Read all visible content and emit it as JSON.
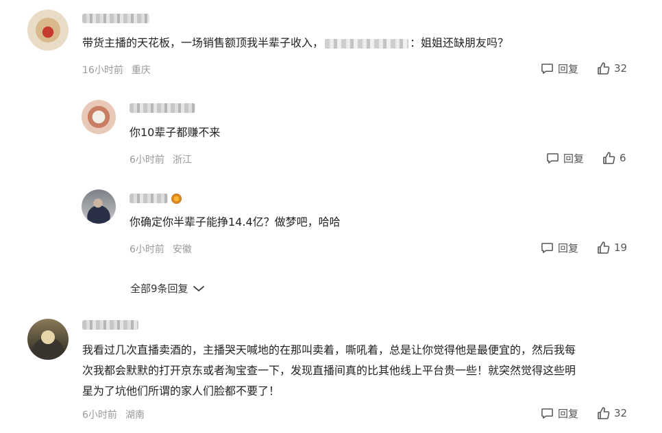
{
  "comments": [
    {
      "text_before": "带货主播的天花板，一场销售额顶我半辈子收入，",
      "text_after": "：姐姐还缺朋友吗？",
      "time": "16小时前",
      "location": "重庆",
      "reply_label": "回复",
      "likes": "32"
    },
    {
      "text": "你10辈子都赚不来",
      "time": "6小时前",
      "location": "浙江",
      "reply_label": "回复",
      "likes": "6"
    },
    {
      "text": "你确定你半辈子能挣14.4亿？做梦吧，哈哈",
      "time": "6小时前",
      "location": "安徽",
      "reply_label": "回复",
      "likes": "19"
    },
    {
      "text_line1": "我看过几次直播卖酒的，主播哭天喊地的在那叫卖着，嘶吼着，总是让你觉得他是最便宜的，然后我每",
      "text_line2": "次我都会默默的打开京东或者淘宝查一下，发现直播间真的比其他线上平台贵一些！就突然觉得这些明",
      "text_line3": "星为了坑他们所谓的家人们脸都不要了！",
      "time": "6小时前",
      "location": "湖南",
      "reply_label": "回复",
      "likes": "32"
    }
  ],
  "more_replies_label": "全部9条回复",
  "icons": {
    "reply": "comment-bubble-icon",
    "like": "thumbs-up-icon",
    "expand": "chevron-down-icon",
    "badge": "user-badge-icon"
  },
  "colors": {
    "text": "#222222",
    "meta": "#999999",
    "action": "#555555"
  }
}
